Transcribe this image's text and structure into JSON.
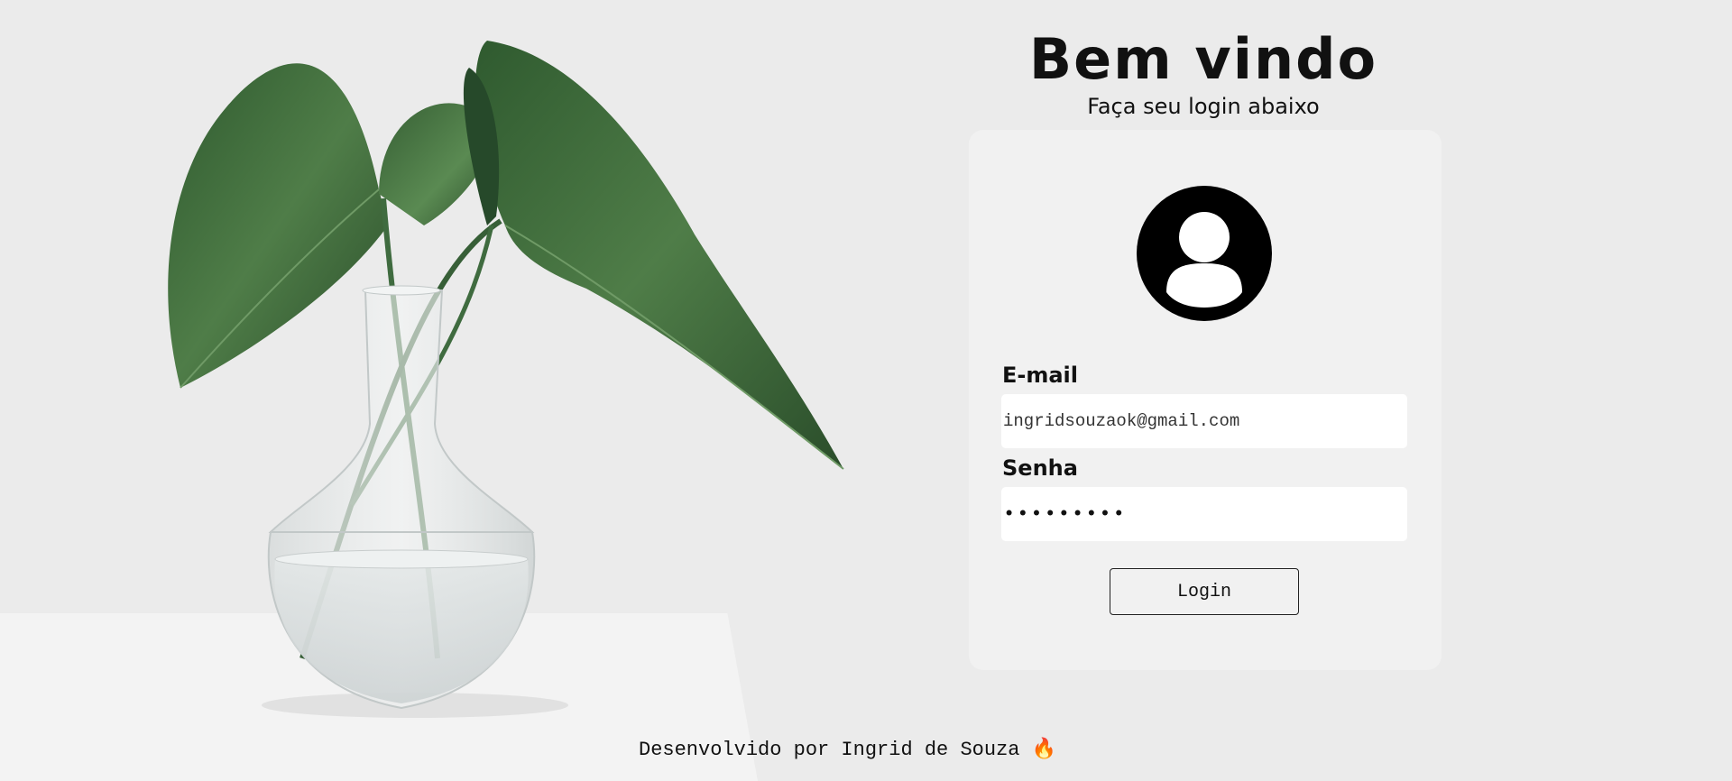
{
  "header": {
    "title": "Bem vindo",
    "subtitle": "Faça seu login abaixo"
  },
  "hero": {
    "icon": "plant-vase-image"
  },
  "login_form": {
    "avatar_icon": "user-avatar-icon",
    "email_label": "E-mail",
    "email_value": "ingridsouzaok@gmail.com",
    "password_label": "Senha",
    "password_value": "•••••••••",
    "login_button": "Login"
  },
  "footer": {
    "text": "Desenvolvido por Ingrid de Souza 🔥"
  },
  "colors": {
    "background": "#ebebeb",
    "card": "#f1f1f1",
    "leaf": "#3f6b3f",
    "text": "#111111"
  }
}
